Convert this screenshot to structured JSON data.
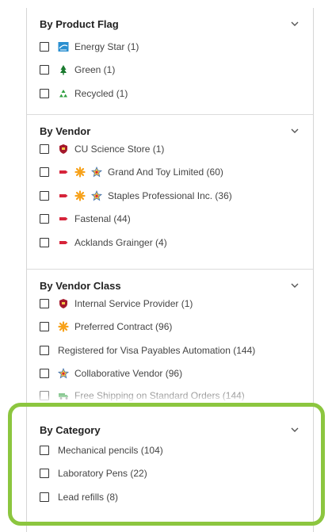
{
  "sections": [
    {
      "title": "By Product Flag",
      "items": [
        {
          "label": "Energy Star (1)",
          "icon": "energy-star-icon"
        },
        {
          "label": "Green (1)",
          "icon": "tree-icon"
        },
        {
          "label": "Recycled (1)",
          "icon": "recycle-icon"
        }
      ]
    },
    {
      "title": "By Vendor",
      "items": [
        {
          "label": "CU Science Store (1)",
          "icon": "shield-icon"
        },
        {
          "label": "Grand And Toy Limited (60)",
          "icons": [
            "tag-icon",
            "star-burst-icon",
            "collaborative-star-icon"
          ]
        },
        {
          "label": "Staples Professional Inc. (36)",
          "icons": [
            "tag-icon",
            "star-burst-icon",
            "collaborative-star-icon"
          ]
        },
        {
          "label": "Fastenal (44)",
          "icon": "tag-icon"
        },
        {
          "label": "Acklands Grainger (4)",
          "icon": "tag-icon"
        }
      ]
    },
    {
      "title": "By Vendor Class",
      "items": [
        {
          "label": "Internal Service Provider (1)",
          "icon": "shield-icon"
        },
        {
          "label": "Preferred Contract (96)",
          "icon": "star-burst-icon"
        },
        {
          "label": "Registered for Visa Payables Automation (144)"
        },
        {
          "label": "Collaborative Vendor (96)",
          "icon": "collaborative-star-icon"
        },
        {
          "label": "Free Shipping on Standard Orders (144)",
          "icon": "truck-icon"
        }
      ]
    },
    {
      "title": "By Category",
      "items": [
        {
          "label": "Mechanical pencils (104)"
        },
        {
          "label": "Laboratory Pens (22)"
        },
        {
          "label": "Lead refills (8)"
        }
      ]
    }
  ],
  "colors": {
    "highlight": "#8cc63f",
    "tag": "#d6243a",
    "star_burst": "#f7a21b",
    "tree": "#1a7a2e",
    "recycle": "#2e9e3e",
    "energy_star": "#2a8fd0",
    "shield": "#a4182b"
  }
}
